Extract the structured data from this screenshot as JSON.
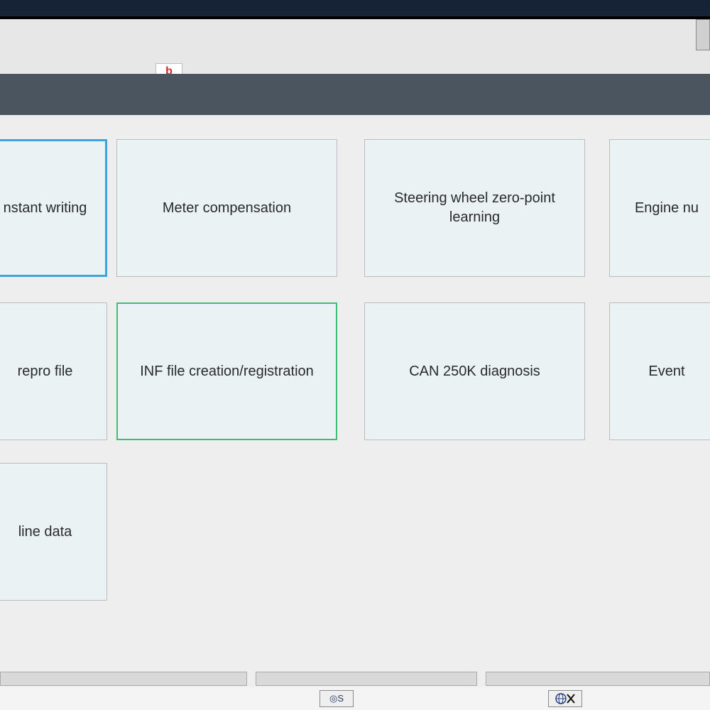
{
  "tiles": {
    "row1": [
      {
        "label": "nstant writing"
      },
      {
        "label": "Meter compensation"
      },
      {
        "label": "Steering wheel zero-point learning"
      },
      {
        "label": "Engine nu"
      }
    ],
    "row2": [
      {
        "label": "repro file"
      },
      {
        "label": "INF file creation/registration"
      },
      {
        "label": "CAN 250K diagnosis"
      },
      {
        "label": "Event"
      }
    ],
    "row3": [
      {
        "label": "line data"
      }
    ]
  },
  "red_tab": "b",
  "footer_icon1": "◎S"
}
